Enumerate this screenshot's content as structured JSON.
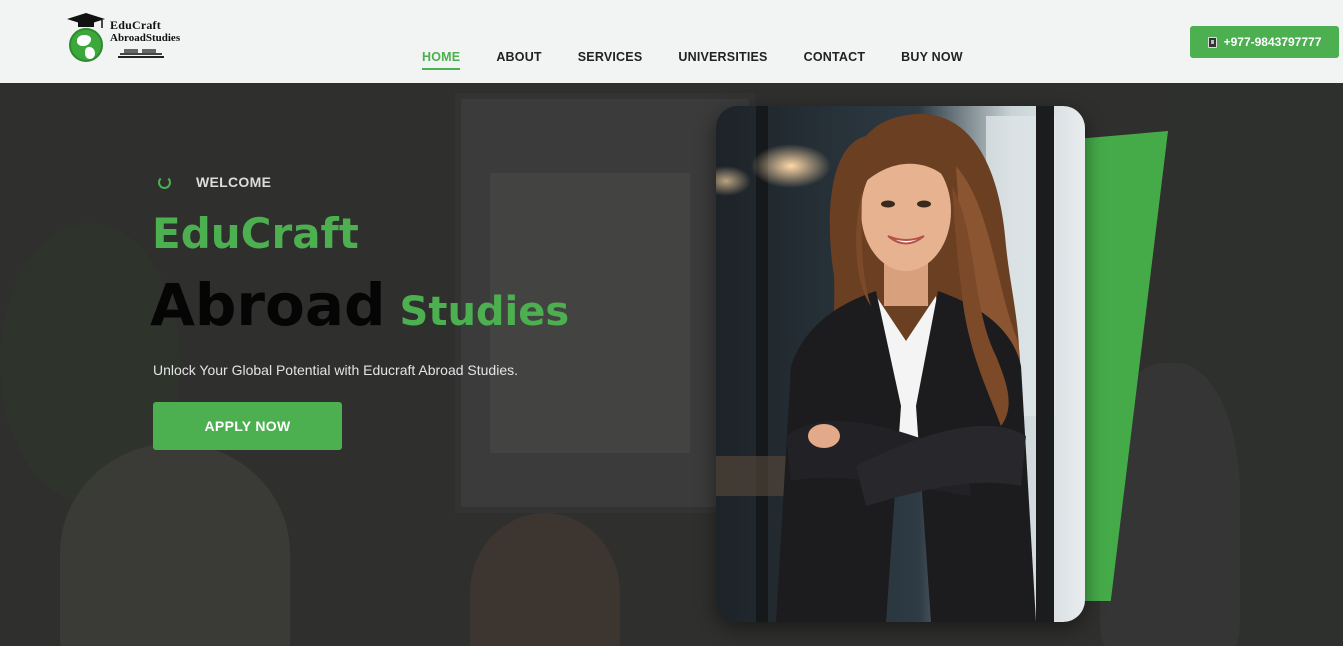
{
  "brand": {
    "logo_line1": "EduCraft",
    "logo_line2": "AbroadStudies",
    "logo_icon": "graduation-globe-icon"
  },
  "nav": {
    "items": [
      {
        "label": "HOME",
        "active": true
      },
      {
        "label": "ABOUT",
        "active": false
      },
      {
        "label": "SERVICES",
        "active": false
      },
      {
        "label": "UNIVERSITIES",
        "active": false
      },
      {
        "label": "CONTACT",
        "active": false
      },
      {
        "label": "BUY NOW",
        "active": false
      }
    ]
  },
  "contact": {
    "phone_icon": "phone-icon",
    "phone_label": "+977-9843797777"
  },
  "hero": {
    "welcome": "WELCOME",
    "title_line1": "EduCraft",
    "title_word_a": "Abroad",
    "title_word_b": "Studies",
    "subtitle": "Unlock Your Global Potential with Educraft Abroad Studies.",
    "cta_label": "APPLY NOW"
  },
  "colors": {
    "accent": "#4caf50",
    "header_bg": "#f2f4f3",
    "hero_bg": "#2f2f2e"
  }
}
